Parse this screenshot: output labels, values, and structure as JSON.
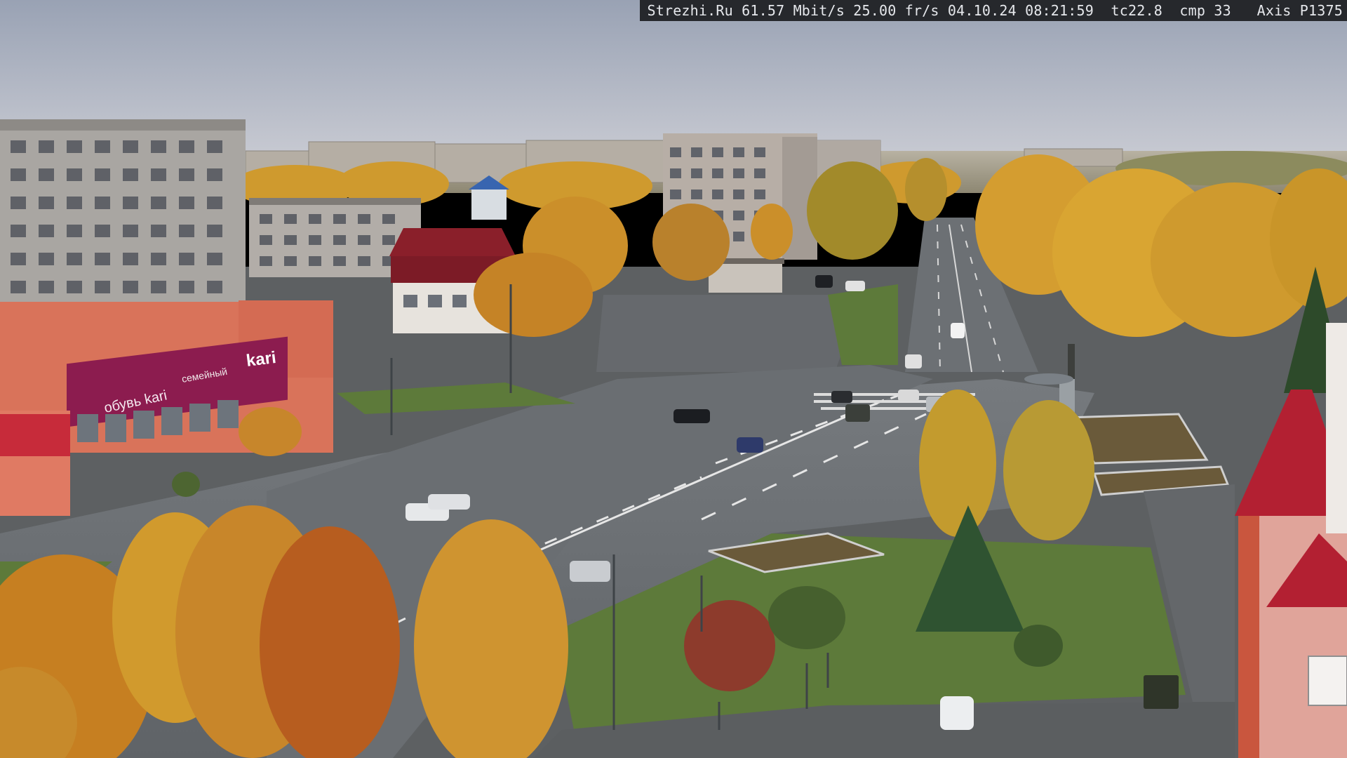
{
  "camera_overlay": {
    "text": "Strezhi.Ru 61.57 Mbit/s 25.00 fr/s 04.10.24 08:21:59  tc22.8  cmp 33   Axis P1375"
  },
  "signs": {
    "shop_brand": "kari",
    "shop_banner": "обувь kari",
    "shop_side": "семейный"
  },
  "colors": {
    "sky_top": "#9aa3b4",
    "sky_bottom": "#c7cad3",
    "foliage": "#d29a2c",
    "road": "#6b6f73",
    "grass": "#5d7a3a",
    "shop_facade": "#d9735a",
    "shop_banner": "#8c1c4f",
    "red_roof": "#b32032"
  }
}
